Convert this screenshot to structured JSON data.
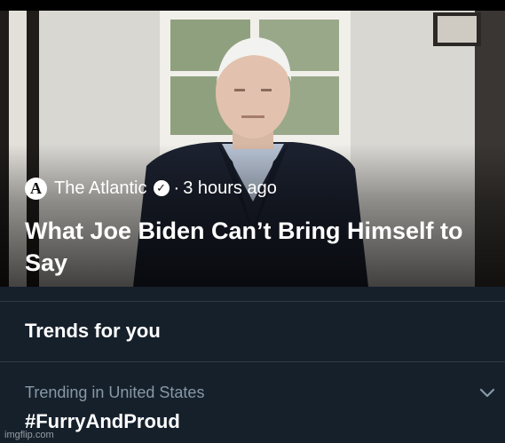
{
  "article": {
    "source": "The Atlantic",
    "logo_letter": "A",
    "separator": "·",
    "time": "3 hours ago",
    "headline": "What Joe Biden Can’t Bring Himself to Say",
    "verified_icon": "verified-badge-icon"
  },
  "trends": {
    "title": "Trends for you",
    "items": [
      {
        "context": "Trending in United States",
        "name": "#FurryAndProud"
      }
    ],
    "more_icon": "chevron-down-icon"
  },
  "watermark": "imgflip.com",
  "colors": {
    "panel_bg": "#15202b",
    "muted_text": "#8899a6",
    "divider": "#2f3b48"
  }
}
